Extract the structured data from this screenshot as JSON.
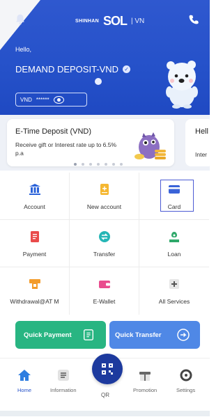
{
  "header": {
    "brand_small": "SHINHAN",
    "brand_sol": "SOL",
    "brand_region": "| VN",
    "greeting": "Hello,",
    "account_name": "DEMAND DEPOSIT-VND",
    "balance_currency": "VND",
    "balance_masked": "******"
  },
  "promos": [
    {
      "title": "E-Time Deposit (VND)",
      "desc": "Receive gift or Interest rate up to 6.5% p.a"
    },
    {
      "title": "Hell",
      "desc": "Inter"
    }
  ],
  "services": [
    {
      "label": "Account",
      "icon": "bank-icon"
    },
    {
      "label": "New account",
      "icon": "new-account-icon"
    },
    {
      "label": "Card",
      "icon": "card-icon"
    },
    {
      "label": "Payment",
      "icon": "payment-icon"
    },
    {
      "label": "Transfer",
      "icon": "transfer-icon"
    },
    {
      "label": "Loan",
      "icon": "loan-icon"
    },
    {
      "label": "Withdrawal@AT M",
      "icon": "withdrawal-icon"
    },
    {
      "label": "E-Wallet",
      "icon": "wallet-icon"
    },
    {
      "label": "All Services",
      "icon": "plus-icon"
    }
  ],
  "quick": {
    "payment_label": "Quick Payment",
    "transfer_label": "Quick Transfer"
  },
  "nav": {
    "home": "Home",
    "information": "Information",
    "qr": "QR",
    "promotion": "Promotion",
    "settings": "Settings"
  },
  "colors": {
    "header_blue": "#2551c9",
    "quick_payment_green": "#28b582",
    "quick_transfer_blue": "#4f88e6",
    "qr_button": "#1d3a9e"
  }
}
